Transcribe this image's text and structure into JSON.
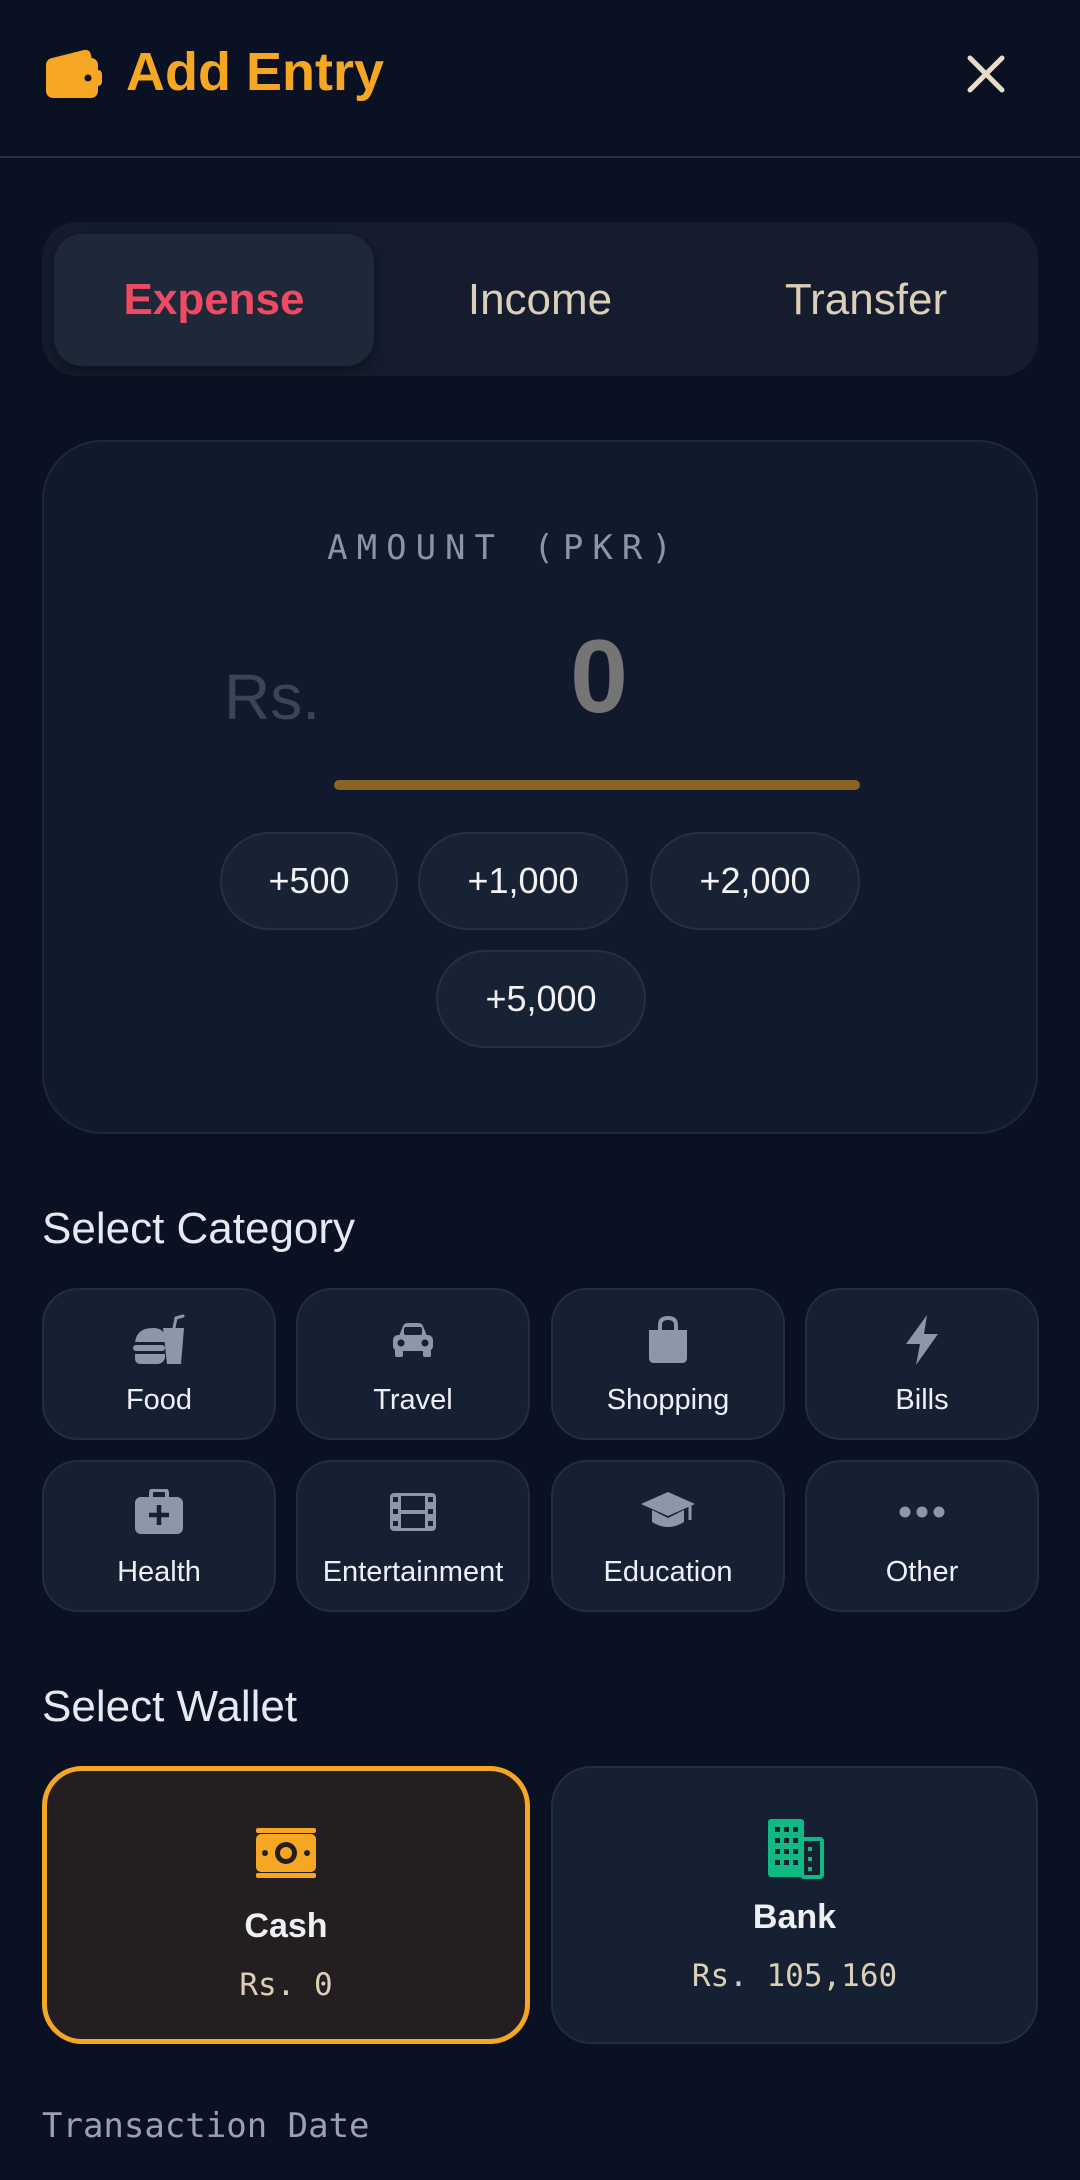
{
  "header": {
    "title": "Add Entry",
    "icon": "wallet-icon",
    "close_icon": "close-icon",
    "accent_color": "#f5a623"
  },
  "entry_type_tabs": [
    {
      "label": "Expense",
      "active": true
    },
    {
      "label": "Income",
      "active": false
    },
    {
      "label": "Transfer",
      "active": false
    }
  ],
  "amount": {
    "label": "AMOUNT (PKR)",
    "currency_prefix": "Rs.",
    "value": "0",
    "quick_add": [
      "+500",
      "+1,000",
      "+2,000",
      "+5,000"
    ]
  },
  "category_section": {
    "title": "Select Category",
    "items": [
      {
        "label": "Food",
        "icon": "burger-soda-icon"
      },
      {
        "label": "Travel",
        "icon": "car-icon"
      },
      {
        "label": "Shopping",
        "icon": "shopping-bag-icon"
      },
      {
        "label": "Bills",
        "icon": "bolt-icon"
      },
      {
        "label": "Health",
        "icon": "medical-kit-icon"
      },
      {
        "label": "Entertainment",
        "icon": "film-icon"
      },
      {
        "label": "Education",
        "icon": "graduation-cap-icon"
      },
      {
        "label": "Other",
        "icon": "ellipsis-icon"
      }
    ]
  },
  "wallet_section": {
    "title": "Select Wallet",
    "wallets": [
      {
        "name": "Cash",
        "balance": "Rs. 0",
        "icon": "money-bill-icon",
        "selected": true,
        "icon_color": "#f5a623"
      },
      {
        "name": "Bank",
        "balance": "Rs. 105,160",
        "icon": "building-icon",
        "selected": false,
        "icon_color": "#10b981"
      }
    ]
  },
  "date_section": {
    "label": "Transaction Date"
  }
}
